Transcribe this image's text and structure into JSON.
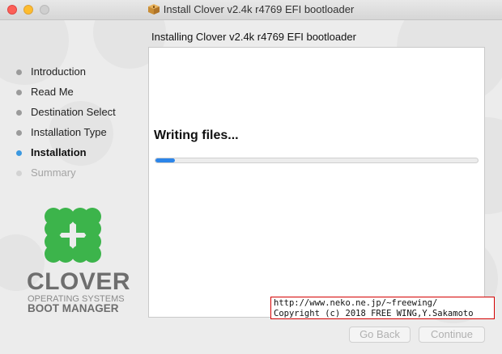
{
  "window": {
    "title": "Install Clover v2.4k r4769 EFI bootloader"
  },
  "sidebar": {
    "steps": [
      {
        "label": "Introduction",
        "state": "done"
      },
      {
        "label": "Read Me",
        "state": "done"
      },
      {
        "label": "Destination Select",
        "state": "done"
      },
      {
        "label": "Installation Type",
        "state": "done"
      },
      {
        "label": "Installation",
        "state": "active"
      },
      {
        "label": "Summary",
        "state": "pending"
      }
    ]
  },
  "logo": {
    "name": "CLOVER",
    "line1": "OPERATING SYSTEMS",
    "line2": "BOOT MANAGER",
    "color": "#3cb44b"
  },
  "main": {
    "header": "Installing Clover v2.4k r4769 EFI bootloader",
    "status": "Writing files...",
    "progress_fraction": 0.06
  },
  "watermark": {
    "line1": "http://www.neko.ne.jp/~freewing/",
    "line2": "Copyright (c) 2018 FREE WING,Y.Sakamoto"
  },
  "buttons": {
    "back": "Go Back",
    "continue": "Continue"
  },
  "colors": {
    "accent": "#2c85e9",
    "active_dot": "#3b98e0",
    "watermark_border": "#d40000"
  }
}
